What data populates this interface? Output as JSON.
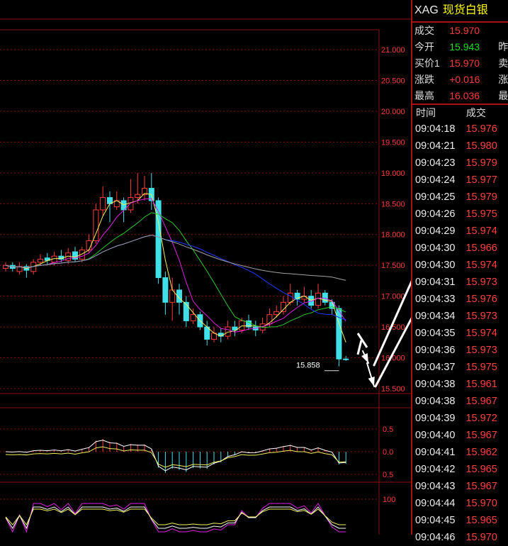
{
  "quote": {
    "symbol": "XAG",
    "name": "现货白银",
    "rows": [
      {
        "label": "成交",
        "value": "15.970",
        "color": "red",
        "extra": ""
      },
      {
        "label": "今开",
        "value": "15.943",
        "color": "green",
        "extra": "昨"
      },
      {
        "label": "买价1",
        "value": "15.970",
        "color": "red",
        "extra": "卖"
      },
      {
        "label": "涨跌",
        "value": "+0.016",
        "color": "red",
        "extra": "涨"
      },
      {
        "label": "最高",
        "value": "16.036",
        "color": "red",
        "extra": "最"
      }
    ],
    "ticks_header": {
      "time": "时间",
      "price": "成交"
    },
    "ticks": [
      {
        "time": "09:04:18",
        "price": "15.976"
      },
      {
        "time": "09:04:21",
        "price": "15.980"
      },
      {
        "time": "09:04:23",
        "price": "15.979"
      },
      {
        "time": "09:04:24",
        "price": "15.977"
      },
      {
        "time": "09:04:25",
        "price": "15.979"
      },
      {
        "time": "09:04:26",
        "price": "15.975"
      },
      {
        "time": "09:04:29",
        "price": "15.974"
      },
      {
        "time": "09:04:30",
        "price": "15.966"
      },
      {
        "time": "09:04:30",
        "price": "15.974"
      },
      {
        "time": "09:04:31",
        "price": "15.973"
      },
      {
        "time": "09:04:33",
        "price": "15.976"
      },
      {
        "time": "09:04:34",
        "price": "15.973"
      },
      {
        "time": "09:04:35",
        "price": "15.974"
      },
      {
        "time": "09:04:36",
        "price": "15.973"
      },
      {
        "time": "09:04:37",
        "price": "15.975"
      },
      {
        "time": "09:04:38",
        "price": "15.961"
      },
      {
        "time": "09:04:38",
        "price": "15.967"
      },
      {
        "time": "09:04:39",
        "price": "15.972"
      },
      {
        "time": "09:04:40",
        "price": "15.967"
      },
      {
        "time": "09:04:41",
        "price": "15.962"
      },
      {
        "time": "09:04:42",
        "price": "15.965"
      },
      {
        "time": "09:04:43",
        "price": "15.967"
      },
      {
        "time": "09:04:44",
        "price": "15.970"
      },
      {
        "time": "09:04:45",
        "price": "15.965"
      },
      {
        "time": "09:04:46",
        "price": "15.970"
      }
    ]
  },
  "kline": {
    "price_ticks": [
      "21.000",
      "20.500",
      "20.000",
      "19.500",
      "19.000",
      "18.500",
      "18.000",
      "17.500",
      "17.000",
      "16.500",
      "16.000",
      "15.500"
    ],
    "price_ymin": 15.5,
    "price_ymax": 21.0,
    "low_marker": "15.858",
    "macd_ticks": [
      "0.5",
      "0.0",
      "0.5"
    ],
    "osc_ticks": [
      "100"
    ],
    "candles": [
      [
        17.45,
        17.5,
        17.55,
        17.4
      ],
      [
        17.5,
        17.45,
        17.55,
        17.4
      ],
      [
        17.4,
        17.48,
        17.55,
        17.35
      ],
      [
        17.48,
        17.42,
        17.52,
        17.3
      ],
      [
        17.4,
        17.55,
        17.6,
        17.35
      ],
      [
        17.55,
        17.6,
        17.68,
        17.5
      ],
      [
        17.62,
        17.58,
        17.7,
        17.5
      ],
      [
        17.55,
        17.65,
        17.72,
        17.5
      ],
      [
        17.65,
        17.6,
        17.75,
        17.55
      ],
      [
        17.58,
        17.7,
        17.78,
        17.52
      ],
      [
        17.72,
        17.6,
        17.8,
        17.55
      ],
      [
        17.6,
        17.75,
        17.8,
        17.55
      ],
      [
        17.75,
        17.9,
        18.0,
        17.7
      ],
      [
        17.9,
        18.4,
        18.5,
        17.85
      ],
      [
        18.4,
        18.6,
        18.78,
        18.3
      ],
      [
        18.6,
        18.5,
        18.7,
        18.2
      ],
      [
        18.45,
        18.55,
        18.7,
        18.4
      ],
      [
        18.55,
        18.4,
        18.6,
        18.2
      ],
      [
        18.4,
        18.6,
        18.9,
        18.35
      ],
      [
        18.6,
        18.65,
        19.0,
        18.5
      ],
      [
        18.65,
        18.75,
        18.95,
        18.55
      ],
      [
        18.75,
        18.55,
        19.0,
        18.4
      ],
      [
        18.55,
        17.3,
        18.6,
        17.2
      ],
      [
        17.3,
        16.9,
        17.4,
        16.7
      ],
      [
        16.9,
        17.1,
        17.3,
        16.6
      ],
      [
        17.1,
        16.9,
        17.2,
        16.7
      ],
      [
        16.9,
        16.6,
        17.0,
        16.5
      ],
      [
        16.6,
        16.7,
        16.8,
        16.55
      ],
      [
        16.7,
        16.5,
        16.75,
        16.45
      ],
      [
        16.5,
        16.3,
        16.6,
        16.2
      ],
      [
        16.3,
        16.4,
        16.5,
        16.25
      ],
      [
        16.4,
        16.35,
        16.48,
        16.25
      ],
      [
        16.35,
        16.5,
        16.6,
        16.3
      ],
      [
        16.5,
        16.45,
        16.6,
        16.35
      ],
      [
        16.45,
        16.6,
        16.65,
        16.4
      ],
      [
        16.6,
        16.5,
        16.7,
        16.45
      ],
      [
        16.5,
        16.45,
        16.6,
        16.35
      ],
      [
        16.45,
        16.55,
        16.65,
        16.4
      ],
      [
        16.55,
        16.7,
        16.8,
        16.5
      ],
      [
        16.7,
        16.75,
        16.85,
        16.65
      ],
      [
        16.75,
        16.9,
        17.0,
        16.7
      ],
      [
        16.9,
        17.05,
        17.2,
        16.85
      ],
      [
        17.05,
        16.95,
        17.1,
        16.85
      ],
      [
        16.95,
        17.0,
        17.15,
        16.9
      ],
      [
        17.0,
        16.85,
        17.1,
        16.8
      ],
      [
        16.85,
        17.05,
        17.2,
        16.8
      ],
      [
        17.05,
        16.9,
        17.1,
        16.85
      ],
      [
        16.9,
        16.8,
        16.95,
        16.7
      ],
      [
        16.8,
        15.98,
        16.85,
        15.86
      ],
      [
        15.98,
        15.97,
        16.03,
        15.95
      ]
    ],
    "colors": {
      "up": "#ff3b3b",
      "down": "#40e0e8",
      "ma_blue": "#1f3bff",
      "ma_green": "#2ecc2e",
      "ma_magenta": "#e020e0",
      "ma_yellow": "#f0f060",
      "ma_gray": "#a0a0a0",
      "grid": "#8a1010",
      "axis_text": "#ff3b3b"
    }
  }
}
